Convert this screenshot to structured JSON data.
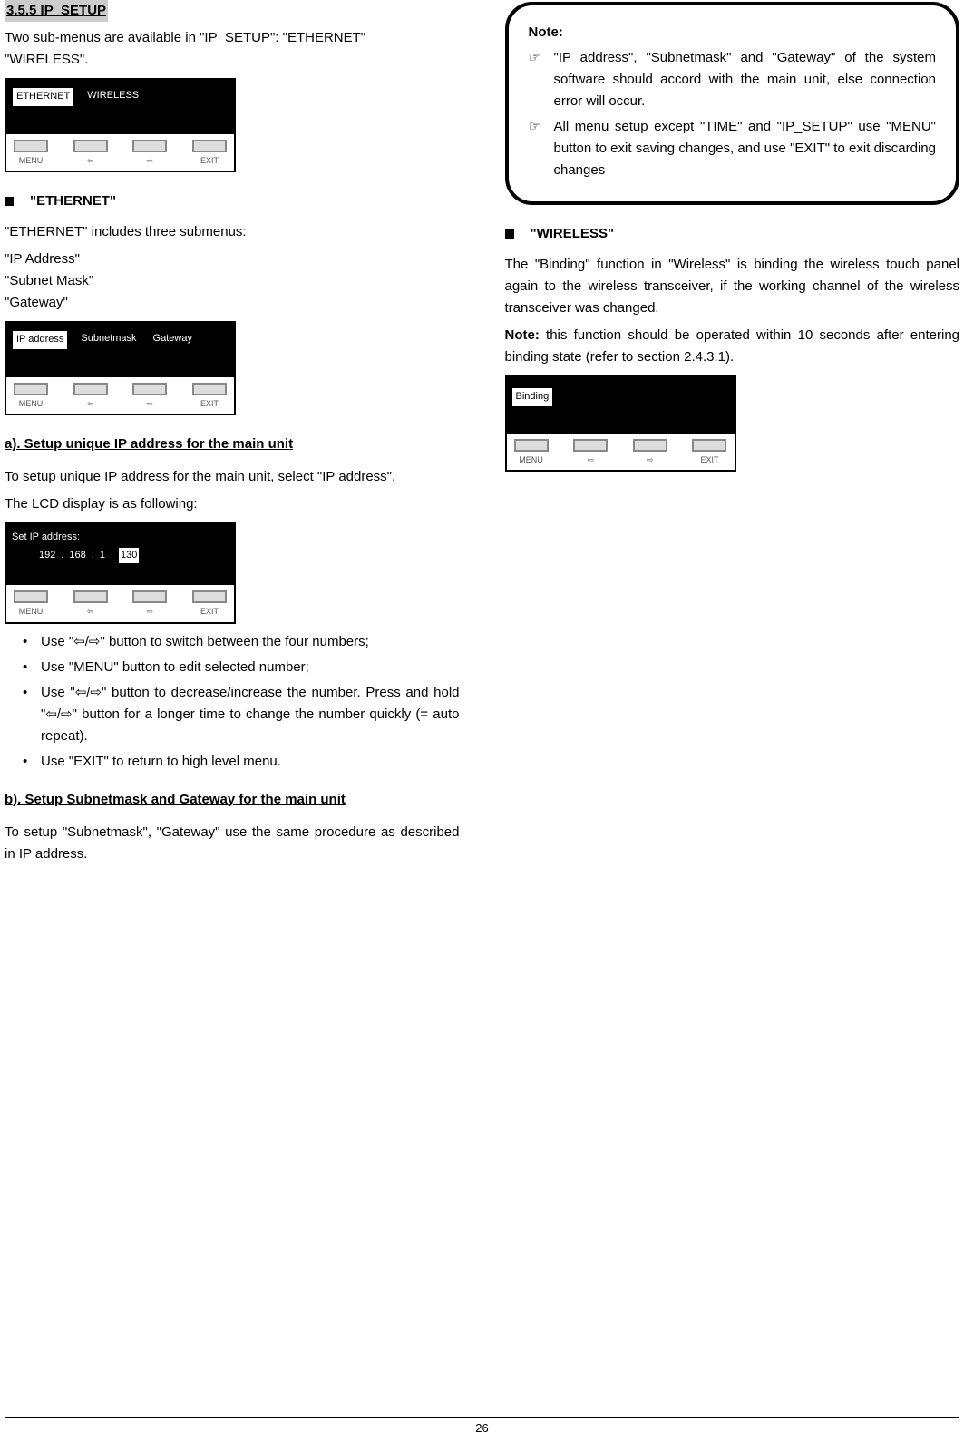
{
  "section_number": "3.5.5 IP_SETUP",
  "intro_text": "Two sub-menus are available in \"IP_SETUP\": \"ETHERNET\"",
  "intro_text2": "\"WIRELESS\".",
  "lcd1": {
    "tab_active": "ETHERNET",
    "tab_inactive": "WIRELESS",
    "btn1": "MENU",
    "btn2": "⇦",
    "btn3": "⇨",
    "btn4": "EXIT"
  },
  "ethernet_heading": "\"ETHERNET\"",
  "ethernet_intro": "\"ETHERNET\" includes three submenus:",
  "ethernet_sub1": "\"IP Address\"",
  "ethernet_sub2": "\"Subnet Mask\"",
  "ethernet_sub3": "\"Gateway\"",
  "lcd2": {
    "tab_active": "IP address",
    "tab2": "Subnetmask",
    "tab3": "Gateway",
    "btn1": "MENU",
    "btn2": "⇦",
    "btn3": "⇨",
    "btn4": "EXIT"
  },
  "heading_a": "a). Setup unique IP address for the main unit",
  "para_a1": "To setup unique IP address for the main unit, select \"IP address\".",
  "para_a2": "The LCD display is as following:",
  "lcd3": {
    "title": "Set IP address:",
    "n1": "192",
    "n2": "168",
    "n3": "1",
    "n4": "130",
    "btn1": "MENU",
    "btn2": "⇦",
    "btn3": "⇨",
    "btn4": "EXIT"
  },
  "bullets_a": [
    "Use \"⇦/⇨\" button to switch between the four numbers;",
    "Use \"MENU\" button to edit selected number;",
    "Use \"⇦/⇨\" button to decrease/increase the number. Press and hold \"⇦/⇨\" button for a longer time to change the number quickly (= auto repeat).",
    "Use \"EXIT\" to return to high level menu."
  ],
  "heading_b": "b). Setup Subnetmask and Gateway for the main unit",
  "para_b": "To setup \"Subnetmask\", \"Gateway\" use the same procedure as described in IP address.",
  "note_heading": "Note:",
  "note_items": [
    "\"IP address\", \"Subnetmask\" and \"Gateway\" of the system software should accord with the main unit, else connection error will occur.",
    "All menu setup except \"TIME\" and \"IP_SETUP\" use \"MENU\" button to exit saving changes, and use \"EXIT\" to exit discarding changes"
  ],
  "wireless_heading": "\"WIRELESS\"",
  "wireless_para": "The \"Binding\" function in \"Wireless\" is binding the wireless touch panel again to the wireless transceiver, if the working channel of the wireless transceiver was changed.",
  "wireless_note": "Note:",
  "wireless_note_text": " this function should be operated within 10 seconds after entering binding state (refer to section 2.4.3.1).",
  "lcd4": {
    "label": "Binding",
    "btn1": "MENU",
    "btn2": "⇦",
    "btn3": "⇨",
    "btn4": "EXIT"
  },
  "page_number": "26",
  "chart_data": null
}
